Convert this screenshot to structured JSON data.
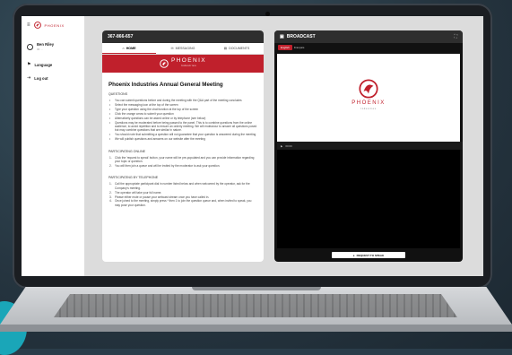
{
  "brand": {
    "name": "PHOENIX",
    "tagline": "Industries",
    "accent": "#c0202c"
  },
  "sidebar": {
    "user": "Ben Riley",
    "user_sub": "ID: ...",
    "items": [
      {
        "label": "Language",
        "icon": "flag-icon"
      },
      {
        "label": "Log out",
        "icon": "logout-icon"
      }
    ]
  },
  "left_panel": {
    "phone": "367-866-657",
    "tabs": [
      {
        "label": "HOME",
        "icon": "home-icon",
        "active": true
      },
      {
        "label": "MESSAGING",
        "icon": "chat-icon",
        "active": false
      },
      {
        "label": "DOCUMENTS",
        "icon": "document-icon",
        "active": false
      }
    ],
    "meeting_title": "Phoenix Industries Annual General Meeting",
    "sections": [
      {
        "heading": "QUESTIONS",
        "list": "bullet",
        "items": [
          "You can submit questions before and during the meeting with the Q&A part of the meeting concludes",
          "Select the messaging icon at the top of the screen",
          "Type your question using the chat function at the top of the screen",
          "Click the orange arrow to submit your question",
          "Alternatively questions can be asked online or by telephone (see below)",
          "Questions may be moderated before being passed to the panel. This is to combine questions from the online audience, to avoid repetition and to ensure an orderly meeting. We will endeavour to answer all questions posed but may combine questions that are similar in nature.",
          "You should note that submitting a question will not guarantee that your question is answered during the meeting",
          "We will publish questions and answers on our website after the meeting"
        ]
      },
      {
        "heading": "PARTICIPATING ONLINE",
        "list": "number",
        "items": [
          "Click the 'request to speak' button, your name will be pre-populated and you can provide information regarding your topic or question.",
          "You will then join a queue and will be invited by the moderator to ask your question."
        ]
      },
      {
        "heading": "PARTICIPATING BY TELEPHONE",
        "list": "number",
        "items": [
          "Call the appropriate participant dial in number listed below and when welcomed by the operator, ask for the Company's meeting.",
          "The operator will take your full name.",
          "Please either mute or pause your webcast stream once you have called in.",
          "Once joined to the meeting, simply press * then 1 to join the question queue and, when invited to speak, you may pose your question."
        ]
      }
    ]
  },
  "broadcast": {
    "title": "BROADCAST",
    "language_selected": "English",
    "language_other": "Français",
    "player_time": "00:00",
    "request_button": "REQUEST TO SPEAK"
  }
}
